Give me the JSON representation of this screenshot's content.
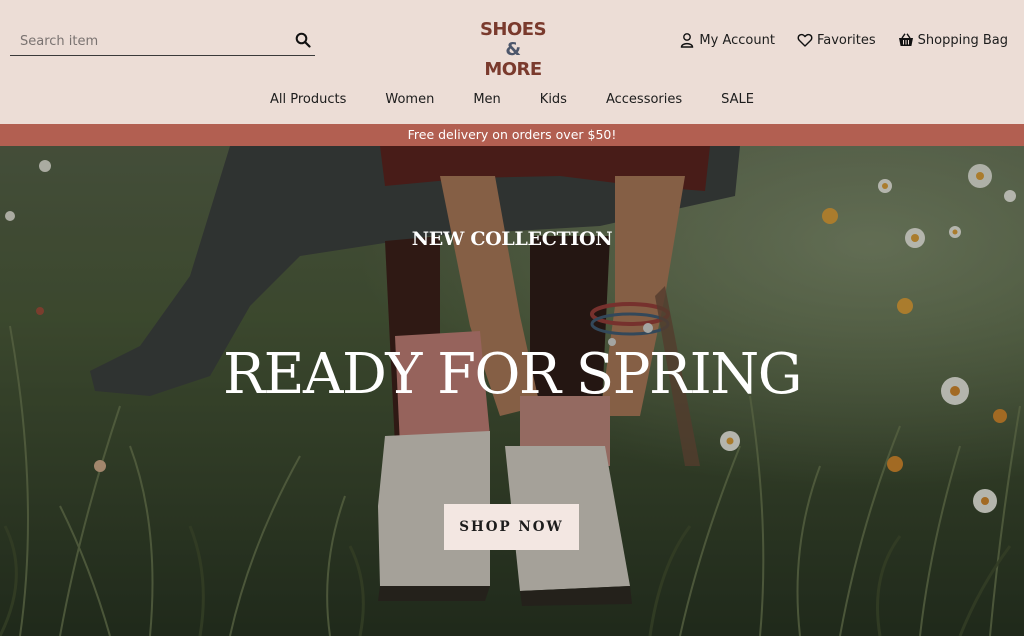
{
  "search": {
    "placeholder": "Search item",
    "icon": "search-icon"
  },
  "logo": {
    "line1_word": "SHOES",
    "line1_symbol": "&",
    "line2": "MORE",
    "colors": {
      "primary": "#7a3a2d",
      "secondary": "#4c566b"
    }
  },
  "utility": {
    "account": {
      "label": "My Account",
      "icon": "user-icon"
    },
    "favorites": {
      "label": "Favorites",
      "icon": "heart-icon"
    },
    "bag": {
      "label": "Shopping Bag",
      "icon": "basket-icon"
    }
  },
  "nav": {
    "items": [
      "All Products",
      "Women",
      "Men",
      "Kids",
      "Accessories",
      "SALE"
    ]
  },
  "promo": {
    "text": "Free delivery on orders over $50!",
    "color": "#b25f51"
  },
  "hero": {
    "eyebrow": "NEW COLLECTION",
    "headline": "READY FOR SPRING",
    "cta": "SHOP NOW"
  }
}
